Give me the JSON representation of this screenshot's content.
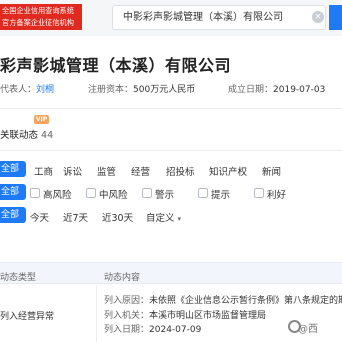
{
  "header": {
    "badge_line1": "全国企业信用查询系统",
    "badge_line2": "官方备案企业征信机构",
    "search_value": "中影彩声影城管理（本溪）有限公司",
    "search_clear": "×"
  },
  "company": {
    "name": "彩声影城管理（本溪）有限公司",
    "legal_rep_label": "代表人：",
    "legal_rep": "刘桐",
    "capital_label": "注册资本：",
    "capital": "500万元人民币",
    "founded_label": "成立日期：",
    "founded": "2019-07-03"
  },
  "dynamics": {
    "vip_badge": "VIP",
    "title": "关联动态",
    "count": "44"
  },
  "filters": {
    "all_label": "全部",
    "categories": [
      "工商",
      "诉讼",
      "监管",
      "经营",
      "招投标",
      "知识产权",
      "新闻"
    ],
    "risk_levels": [
      "高风险",
      "中风险",
      "警示",
      "提示",
      "利好"
    ],
    "time_ranges": [
      "今天",
      "近7天",
      "近30天",
      "自定义"
    ]
  },
  "table": {
    "col_type": "动态类型",
    "col_content": "动态内容",
    "rows": [
      {
        "type": "列入经营异常",
        "reason_label": "列入原因：",
        "reason": "未依照《企业信息公示暂行条例》第八条规定的期",
        "authority_label": "列入机关：",
        "authority": "本溪市明山区市场监督管理局",
        "date_label": "列入日期：",
        "date": "2024-07-09"
      }
    ]
  },
  "watermark": "@西"
}
